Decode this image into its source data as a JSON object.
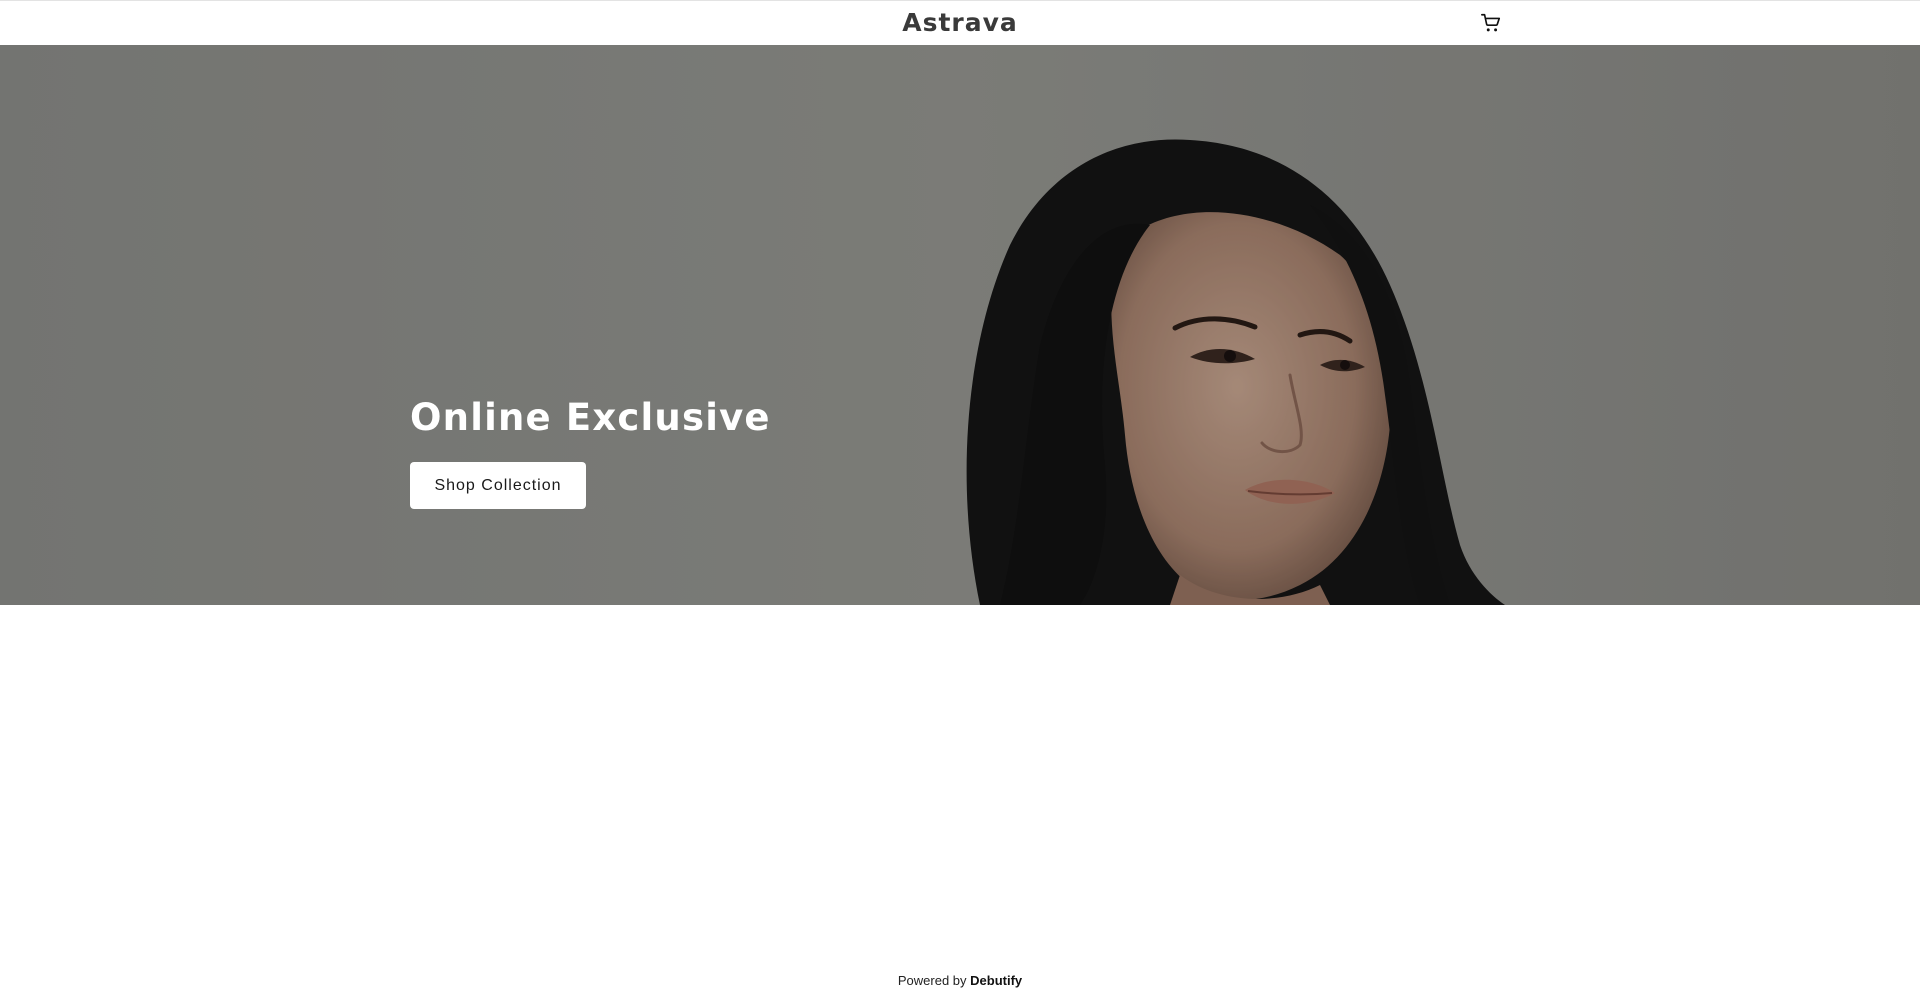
{
  "header": {
    "logo_text": "Astrava",
    "cart_icon": "cart-icon"
  },
  "hero": {
    "title": "Online Exclusive",
    "button_label": "Shop Collection",
    "image_subject": "portrait-photo"
  },
  "footer": {
    "powered_prefix": "Powered by",
    "powered_brand": "Debutify"
  },
  "colors": {
    "header_bg": "#ffffff",
    "hero_bg": "#8b8c88",
    "hero_text": "#ffffff",
    "button_bg": "#ffffff",
    "button_text": "#1a1a1a",
    "logo_text": "#3a3a3a"
  }
}
